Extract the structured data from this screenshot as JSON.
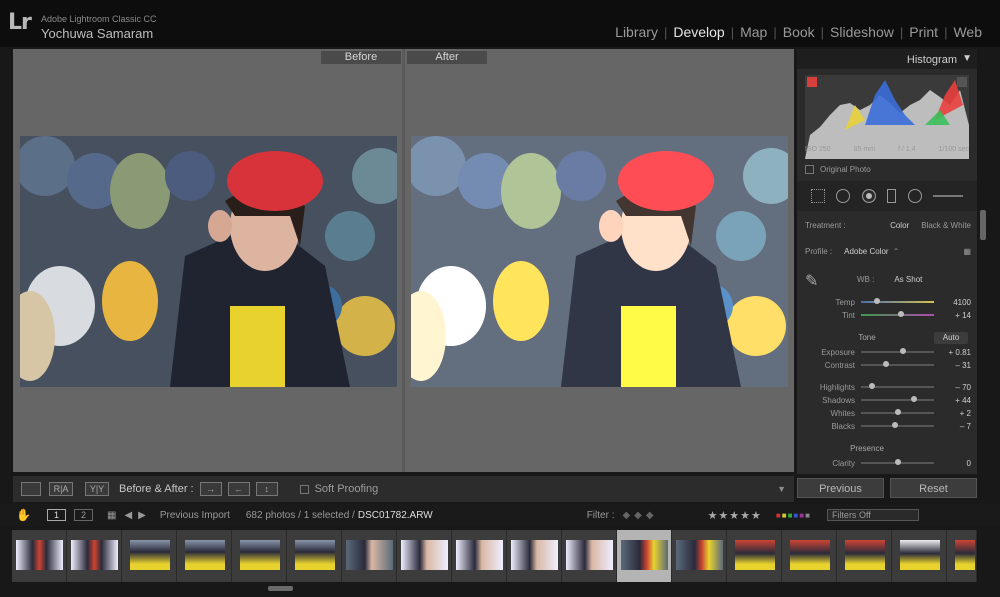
{
  "app": {
    "logo": "Lr",
    "name": "Adobe Lightroom Classic CC",
    "user": "Yochuwa Samaram"
  },
  "modules": [
    {
      "label": "Library",
      "active": false
    },
    {
      "label": "Develop",
      "active": true
    },
    {
      "label": "Map",
      "active": false
    },
    {
      "label": "Book",
      "active": false
    },
    {
      "label": "Slideshow",
      "active": false
    },
    {
      "label": "Print",
      "active": false
    },
    {
      "label": "Web",
      "active": false
    }
  ],
  "view": {
    "before_label": "Before",
    "after_label": "After"
  },
  "toolbar": {
    "ra_label": "R|A",
    "yy_label": "Y|Y",
    "before_after_label": "Before & After :",
    "soft_proofing_label": "Soft Proofing"
  },
  "histogram": {
    "title": "Histogram",
    "iso": "ISO 250",
    "focal": "85 mm",
    "aperture": "f / 1.4",
    "shutter": "1/100 sec",
    "original_photo": "Original Photo"
  },
  "basic": {
    "treatment_label": "Treatment :",
    "treatment_color": "Color",
    "treatment_bw": "Black & White",
    "profile_label": "Profile :",
    "profile_value": "Adobe Color",
    "wb_label": "WB :",
    "wb_value": "As Shot",
    "temp": {
      "label": "Temp",
      "value": "4100",
      "pos": 0.22
    },
    "tint": {
      "label": "Tint",
      "value": "+ 14",
      "pos": 0.55
    },
    "tone_title": "Tone",
    "auto_label": "Auto",
    "exposure": {
      "label": "Exposure",
      "value": "+ 0.81",
      "pos": 0.58
    },
    "contrast": {
      "label": "Contrast",
      "value": "– 31",
      "pos": 0.34
    },
    "highlights": {
      "label": "Highlights",
      "value": "– 70",
      "pos": 0.15
    },
    "shadows": {
      "label": "Shadows",
      "value": "+ 44",
      "pos": 0.72
    },
    "whites": {
      "label": "Whites",
      "value": "+ 2",
      "pos": 0.51
    },
    "blacks": {
      "label": "Blacks",
      "value": "– 7",
      "pos": 0.47
    },
    "presence_title": "Presence",
    "clarity": {
      "label": "Clarity",
      "value": "0",
      "pos": 0.5
    }
  },
  "buttons": {
    "previous": "Previous",
    "reset": "Reset"
  },
  "filmbar": {
    "page1": "1",
    "page2": "2",
    "source": "Previous Import",
    "count": "682 photos / 1 selected /",
    "filename": "DSC01782.ARW",
    "filter_label": "Filter :",
    "filters_off": "Filters Off"
  },
  "colors": {
    "accent": "#e6e6e6",
    "panel": "#2b2b2b",
    "hist_red": "#e8403c",
    "hist_blue": "#3a6ed8",
    "hist_yellow": "#e8d23a"
  }
}
